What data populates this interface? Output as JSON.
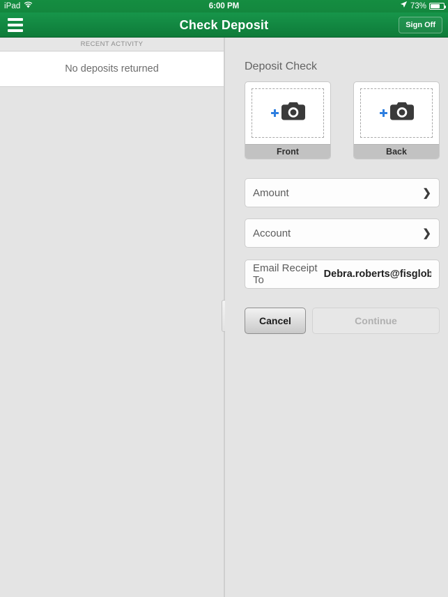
{
  "status_bar": {
    "device": "iPad",
    "wifi_icon": "wifi-icon",
    "time": "6:00 PM",
    "location_icon": "location-arrow-icon",
    "battery_percent": "73%",
    "battery_icon": "battery-icon"
  },
  "nav_bar": {
    "menu_icon": "hamburger-menu-icon",
    "title": "Check Deposit",
    "sign_off_label": "Sign Off"
  },
  "left_pane": {
    "section_header": "RECENT ACTIVITY",
    "empty_message": "No deposits returned"
  },
  "splitter": {
    "grip_icon": "splitter-grip-icon"
  },
  "right_pane": {
    "title": "Deposit Check",
    "captures": [
      {
        "label": "Front",
        "plus_icon": "plus-icon",
        "camera_icon": "camera-icon"
      },
      {
        "label": "Back",
        "plus_icon": "plus-icon",
        "camera_icon": "camera-icon"
      }
    ],
    "fields": [
      {
        "label": "Amount",
        "chevron": "❯"
      },
      {
        "label": "Account",
        "chevron": "❯"
      }
    ],
    "email_row": {
      "label": "Email Receipt To",
      "value": "Debra.roberts@fisgloba…"
    },
    "buttons": {
      "cancel_label": "Cancel",
      "continue_label": "Continue"
    }
  },
  "colors": {
    "brand_green": "#14893f",
    "accent_blue": "#2e7fe0",
    "pane_background": "#e4e4e4"
  }
}
